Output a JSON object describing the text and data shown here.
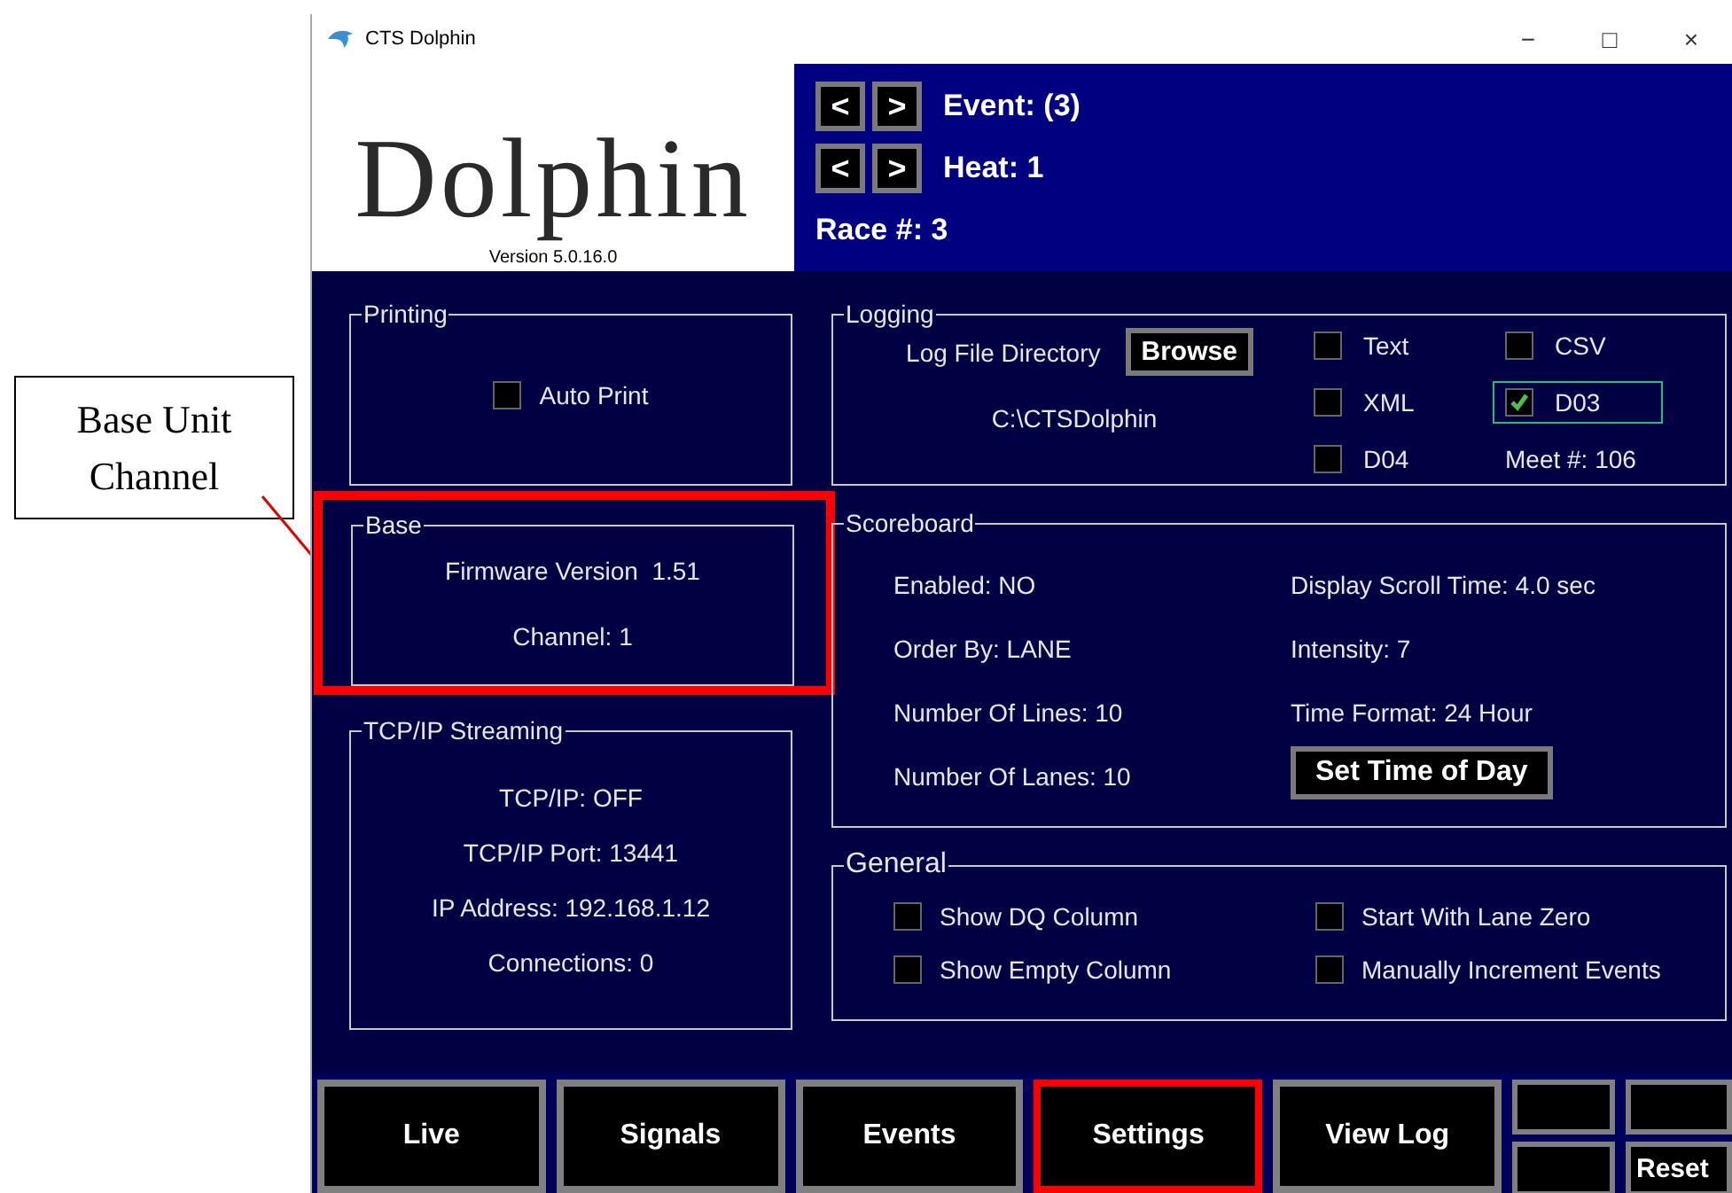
{
  "annotation": {
    "text": "Base Unit Channel"
  },
  "window": {
    "title": "CTS Dolphin",
    "controls": [
      "−",
      "□",
      "×"
    ]
  },
  "logo": {
    "text": "Dolphin",
    "version": "Version 5.0.16.0"
  },
  "race_nav": [
    {
      "prev": "<",
      "next": ">",
      "label": "Event: (3)"
    },
    {
      "prev": "<",
      "next": ">",
      "label": "Heat: 1"
    }
  ],
  "race_number": "Race #: 3",
  "printing": {
    "title": "Printing",
    "options": [
      {
        "label": "Auto Print",
        "checked": false
      }
    ]
  },
  "base": {
    "title": "Base",
    "highlighted": true,
    "lines": [
      "Firmware Version  1.51",
      "Channel: 1"
    ]
  },
  "tcpip": {
    "title": "TCP/IP Streaming",
    "lines": [
      "TCP/IP: OFF",
      "TCP/IP Port: 13441",
      "IP Address: 192.168.1.12",
      "Connections: 0"
    ]
  },
  "logging": {
    "title": "Logging",
    "directory_label": "Log File Directory",
    "browse": "Browse",
    "directory": "C:\\CTSDolphin",
    "meet": "Meet #: 106",
    "formats": [
      {
        "label": "Text",
        "checked": false,
        "focused": false
      },
      {
        "label": "CSV",
        "checked": false,
        "focused": false
      },
      {
        "label": "XML",
        "checked": false,
        "focused": false
      },
      {
        "label": "D03",
        "checked": true,
        "focused": true
      },
      {
        "label": "D04",
        "checked": false,
        "focused": false
      }
    ]
  },
  "scoreboard": {
    "title": "Scoreboard",
    "left": [
      {
        "kind": "text",
        "text": "Enabled: NO"
      },
      {
        "kind": "text",
        "text": "Order By: LANE"
      },
      {
        "kind": "text",
        "text": "Number Of Lines: 10"
      },
      {
        "kind": "text",
        "text": "Number Of Lanes: 10"
      }
    ],
    "right": [
      {
        "kind": "text",
        "text": "Display Scroll Time: 4.0 sec"
      },
      {
        "kind": "text",
        "text": "Intensity: 7"
      },
      {
        "kind": "text",
        "text": "Time Format: 24 Hour"
      },
      {
        "kind": "button",
        "text": "Set Time of Day"
      }
    ]
  },
  "general": {
    "title": "General",
    "options": [
      {
        "label": "Show DQ Column",
        "checked": false
      },
      {
        "label": "Start With Lane Zero",
        "checked": false
      },
      {
        "label": "Show Empty Column",
        "checked": false
      },
      {
        "label": "Manually Increment Events",
        "checked": false
      }
    ]
  },
  "nav_buttons": [
    {
      "label": "Live",
      "selected": false
    },
    {
      "label": "Signals",
      "selected": false
    },
    {
      "label": "Events",
      "selected": false
    },
    {
      "label": "Settings",
      "selected": true
    },
    {
      "label": "View Log",
      "selected": false
    }
  ],
  "small_buttons": [
    {
      "kind": "blank"
    },
    {
      "kind": "blank"
    },
    {
      "kind": "blank"
    },
    {
      "kind": "labeled",
      "label": "Reset"
    }
  ]
}
